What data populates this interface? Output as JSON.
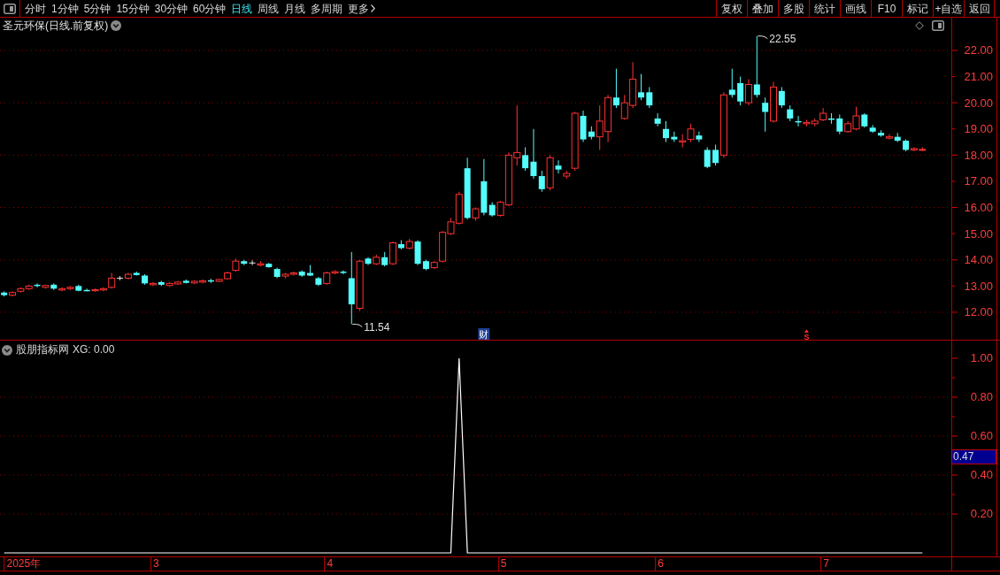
{
  "toolbar": {
    "periods": [
      {
        "label": "分时",
        "kind": "period",
        "selected": false
      },
      {
        "label": "1分钟",
        "kind": "period",
        "selected": false
      },
      {
        "label": "5分钟",
        "kind": "period",
        "selected": false
      },
      {
        "label": "15分钟",
        "kind": "period",
        "selected": false
      },
      {
        "label": "30分钟",
        "kind": "period",
        "selected": false
      },
      {
        "label": "60分钟",
        "kind": "period",
        "selected": false
      },
      {
        "label": "日线",
        "kind": "period",
        "selected": true
      },
      {
        "label": "周线",
        "kind": "period",
        "selected": false
      },
      {
        "label": "月线",
        "kind": "period",
        "selected": false
      },
      {
        "label": "多周期",
        "kind": "period",
        "selected": false
      },
      {
        "label": "更多",
        "kind": "menu",
        "selected": false
      }
    ],
    "buttons": [
      "复权",
      "叠加",
      "多股",
      "统计",
      "画线",
      "F10",
      "标记",
      "+自选",
      "返回"
    ]
  },
  "price_chart": {
    "title": "圣元环保(日线.前复权)",
    "high_label": "22.55",
    "low_label": "11.54",
    "event_markers": [
      {
        "kind": "finance",
        "label": "财"
      },
      {
        "kind": "signal",
        "label": "S"
      }
    ],
    "chart_data": {
      "type": "candlestick",
      "grid": true,
      "ylim": [
        10.95,
        23.25
      ],
      "yticks": [
        {
          "value": 22,
          "label": "22.00"
        },
        {
          "value": 21,
          "label": "21.00"
        },
        {
          "value": 20,
          "label": "20.00"
        },
        {
          "value": 19,
          "label": "19.00"
        },
        {
          "value": 18,
          "label": "18.00"
        },
        {
          "value": 17,
          "label": "17.00"
        },
        {
          "value": 16,
          "label": "16.00"
        },
        {
          "value": 15,
          "label": "15.00"
        },
        {
          "value": 14,
          "label": "14.00"
        },
        {
          "value": 13,
          "label": "13.00"
        },
        {
          "value": 12,
          "label": "12.00"
        }
      ],
      "categories": [
        null,
        null,
        null,
        null,
        null,
        null,
        null,
        null,
        null,
        null,
        null,
        null,
        null,
        null,
        null,
        null,
        null,
        null,
        null,
        null,
        null,
        null,
        null,
        null,
        null,
        null,
        null,
        null,
        null,
        null,
        null,
        null,
        null,
        null,
        null,
        null,
        null,
        null,
        null,
        null,
        null,
        null,
        null,
        null,
        null,
        null,
        null,
        null,
        null,
        null,
        null,
        null,
        null,
        null,
        null,
        null,
        null,
        null,
        null,
        null,
        null,
        null,
        null,
        null,
        null,
        null,
        null,
        null,
        null,
        null,
        null,
        null,
        null,
        null,
        null,
        null,
        null,
        null,
        null,
        null,
        null,
        null,
        null,
        null,
        null,
        null,
        null,
        null,
        null,
        null,
        null,
        null,
        null,
        null,
        null,
        null,
        null,
        null,
        null,
        null,
        null,
        null,
        null,
        null,
        null,
        null,
        null,
        null,
        null,
        null,
        null,
        null,
        null,
        null,
        null
      ],
      "ohlc": [
        [
          12.75,
          12.8,
          12.6,
          12.65
        ],
        [
          12.65,
          12.8,
          12.6,
          12.75
        ],
        [
          12.8,
          12.95,
          12.75,
          12.9
        ],
        [
          12.9,
          13.05,
          12.85,
          13.0
        ],
        [
          13.05,
          13.1,
          12.95,
          13.0
        ],
        [
          12.95,
          13.05,
          12.9,
          13.02
        ],
        [
          13.05,
          13.1,
          12.85,
          12.9
        ],
        [
          12.85,
          12.95,
          12.8,
          12.9
        ],
        [
          12.9,
          13.0,
          12.85,
          12.95
        ],
        [
          13.0,
          13.05,
          12.8,
          12.82
        ],
        [
          12.85,
          12.9,
          12.8,
          12.82
        ],
        [
          12.82,
          12.9,
          12.78,
          12.86
        ],
        [
          12.85,
          12.95,
          12.8,
          12.9
        ],
        [
          12.95,
          13.5,
          12.9,
          13.3
        ],
        [
          13.3,
          13.38,
          13.22,
          13.3
        ],
        [
          13.3,
          13.5,
          13.25,
          13.45
        ],
        [
          13.5,
          13.55,
          13.4,
          13.42
        ],
        [
          13.4,
          13.45,
          13.05,
          13.1
        ],
        [
          13.05,
          13.15,
          13.0,
          13.1
        ],
        [
          13.15,
          13.2,
          13.0,
          13.05
        ],
        [
          13.02,
          13.15,
          12.98,
          13.1
        ],
        [
          13.08,
          13.2,
          13.05,
          13.15
        ],
        [
          13.2,
          13.25,
          13.1,
          13.12
        ],
        [
          13.12,
          13.22,
          13.08,
          13.18
        ],
        [
          13.15,
          13.25,
          13.1,
          13.2
        ],
        [
          13.22,
          13.28,
          13.12,
          13.18
        ],
        [
          13.18,
          13.28,
          13.15,
          13.25
        ],
        [
          13.28,
          13.55,
          13.25,
          13.5
        ],
        [
          13.6,
          14.05,
          13.55,
          13.95
        ],
        [
          13.95,
          14.0,
          13.8,
          13.85
        ],
        [
          13.88,
          13.98,
          13.8,
          13.88
        ],
        [
          13.8,
          13.95,
          13.75,
          13.85
        ],
        [
          13.85,
          13.88,
          13.7,
          13.72
        ],
        [
          13.65,
          13.7,
          13.3,
          13.35
        ],
        [
          13.38,
          13.5,
          13.3,
          13.45
        ],
        [
          13.45,
          13.55,
          13.4,
          13.5
        ],
        [
          13.55,
          13.6,
          13.35,
          13.4
        ],
        [
          13.5,
          13.8,
          13.38,
          13.4
        ],
        [
          13.3,
          13.35,
          13.0,
          13.05
        ],
        [
          13.1,
          13.55,
          13.05,
          13.5
        ],
        [
          13.5,
          13.6,
          13.45,
          13.55
        ],
        [
          13.55,
          13.6,
          13.45,
          13.5
        ],
        [
          13.3,
          14.3,
          11.54,
          12.3
        ],
        [
          12.15,
          14.0,
          12.05,
          13.95
        ],
        [
          14.05,
          14.1,
          13.8,
          13.85
        ],
        [
          13.85,
          14.2,
          13.8,
          14.1
        ],
        [
          14.1,
          14.3,
          13.75,
          13.8
        ],
        [
          13.85,
          14.7,
          13.8,
          14.65
        ],
        [
          14.6,
          14.75,
          14.4,
          14.45
        ],
        [
          14.45,
          14.8,
          14.4,
          14.7
        ],
        [
          14.7,
          14.75,
          13.8,
          13.85
        ],
        [
          13.95,
          14.0,
          13.6,
          13.65
        ],
        [
          13.7,
          13.95,
          13.65,
          13.9
        ],
        [
          13.95,
          15.1,
          13.9,
          15.05
        ],
        [
          15.0,
          15.6,
          14.95,
          15.45
        ],
        [
          15.4,
          16.6,
          15.35,
          16.5
        ],
        [
          17.5,
          17.9,
          15.55,
          15.6
        ],
        [
          15.6,
          16.0,
          15.5,
          15.95
        ],
        [
          17.0,
          17.85,
          15.7,
          15.8
        ],
        [
          16.1,
          16.2,
          15.65,
          15.7
        ],
        [
          15.7,
          16.25,
          15.65,
          16.2
        ],
        [
          16.1,
          18.1,
          16.05,
          18.0
        ],
        [
          17.9,
          19.9,
          17.6,
          18.1
        ],
        [
          18.0,
          18.3,
          17.4,
          17.5
        ],
        [
          17.75,
          19.0,
          17.1,
          17.2
        ],
        [
          17.2,
          17.4,
          16.6,
          16.7
        ],
        [
          16.75,
          18.0,
          16.65,
          17.9
        ],
        [
          17.6,
          17.8,
          17.3,
          17.45
        ],
        [
          17.2,
          17.4,
          17.1,
          17.3
        ],
        [
          17.5,
          19.65,
          17.4,
          19.6
        ],
        [
          19.5,
          19.7,
          18.5,
          18.6
        ],
        [
          18.9,
          19.1,
          18.6,
          18.7
        ],
        [
          18.7,
          19.9,
          18.2,
          19.3
        ],
        [
          18.9,
          20.3,
          18.5,
          20.2
        ],
        [
          20.2,
          21.3,
          19.8,
          19.9
        ],
        [
          19.4,
          20.3,
          19.35,
          20.0
        ],
        [
          19.9,
          21.55,
          19.8,
          20.9
        ],
        [
          20.4,
          21.1,
          20.1,
          20.2
        ],
        [
          20.4,
          20.6,
          19.8,
          19.9
        ],
        [
          19.4,
          19.6,
          19.1,
          19.2
        ],
        [
          19.0,
          19.3,
          18.5,
          18.65
        ],
        [
          18.7,
          18.9,
          18.5,
          18.6
        ],
        [
          18.5,
          18.8,
          18.3,
          18.55
        ],
        [
          18.6,
          19.2,
          18.5,
          19.0
        ],
        [
          18.75,
          18.9,
          18.5,
          18.6
        ],
        [
          18.2,
          18.3,
          17.5,
          17.55
        ],
        [
          18.2,
          18.4,
          17.6,
          17.7
        ],
        [
          18.0,
          20.4,
          17.9,
          20.3
        ],
        [
          20.5,
          21.3,
          20.2,
          20.3
        ],
        [
          20.75,
          21.0,
          19.9,
          20.05
        ],
        [
          20.0,
          20.9,
          19.9,
          20.7
        ],
        [
          20.7,
          22.55,
          20.2,
          20.3
        ],
        [
          20.0,
          20.2,
          18.9,
          19.65
        ],
        [
          19.3,
          20.8,
          19.25,
          20.6
        ],
        [
          20.45,
          20.6,
          19.8,
          19.9
        ],
        [
          19.75,
          19.9,
          19.3,
          19.4
        ],
        [
          19.3,
          19.5,
          19.1,
          19.25
        ],
        [
          19.2,
          19.35,
          19.1,
          19.25
        ],
        [
          19.2,
          19.4,
          19.1,
          19.3
        ],
        [
          19.35,
          19.8,
          19.3,
          19.6
        ],
        [
          19.4,
          19.6,
          19.2,
          19.35
        ],
        [
          19.4,
          19.55,
          18.8,
          18.9
        ],
        [
          18.9,
          19.3,
          18.85,
          19.2
        ],
        [
          19.0,
          19.85,
          18.95,
          19.5
        ],
        [
          19.55,
          19.6,
          19.05,
          19.1
        ],
        [
          19.05,
          19.15,
          18.85,
          18.9
        ],
        [
          18.85,
          18.95,
          18.7,
          18.75
        ],
        [
          18.65,
          18.8,
          18.6,
          18.7
        ],
        [
          18.7,
          18.85,
          18.5,
          18.55
        ],
        [
          18.55,
          18.6,
          18.15,
          18.2
        ],
        [
          18.2,
          18.3,
          18.15,
          18.25
        ],
        [
          18.2,
          18.3,
          18.15,
          18.22
        ],
        null,
        null,
        null
      ]
    }
  },
  "indicator": {
    "name": "股朋指标网",
    "readout": "XG: 0.00",
    "cursor_value": "0.47",
    "chart_data": {
      "type": "line",
      "grid": true,
      "ylim": [
        -0.0181818181818182,
        1.0954545454545455
      ],
      "yticks": [
        {
          "value": 0.2,
          "label": "0.20"
        },
        {
          "value": 0.4,
          "label": "0.40"
        },
        {
          "value": 0.6,
          "label": "0.60"
        },
        {
          "value": 0.8,
          "label": "0.80"
        },
        {
          "value": 1.0,
          "label": "1.00"
        }
      ],
      "categories": [
        null,
        null,
        "2025年",
        null,
        null,
        null,
        null,
        null,
        null,
        null,
        null,
        null,
        null,
        null,
        null,
        null,
        null,
        null,
        "3",
        null,
        null,
        null,
        null,
        null,
        null,
        null,
        null,
        null,
        null,
        null,
        null,
        null,
        null,
        null,
        null,
        null,
        null,
        null,
        null,
        "4",
        null,
        null,
        null,
        null,
        null,
        null,
        null,
        null,
        null,
        null,
        null,
        null,
        null,
        null,
        null,
        null,
        null,
        null,
        null,
        null,
        "5",
        null,
        null,
        null,
        null,
        null,
        null,
        null,
        null,
        null,
        null,
        null,
        null,
        null,
        null,
        null,
        null,
        null,
        null,
        "6",
        null,
        null,
        null,
        null,
        null,
        null,
        null,
        null,
        null,
        null,
        null,
        null,
        null,
        null,
        null,
        null,
        null,
        null,
        null,
        "7",
        null,
        null,
        null,
        null,
        null,
        null,
        null,
        null,
        null,
        null,
        null,
        null,
        null,
        null,
        null
      ],
      "series": [
        {
          "color": "#ffffff",
          "values": [
            0,
            0,
            0,
            0,
            0,
            0,
            0,
            0,
            0,
            0,
            0,
            0,
            0,
            0,
            0,
            0,
            0,
            0,
            0,
            0,
            0,
            0,
            0,
            0,
            0,
            0,
            0,
            0,
            0,
            0,
            0,
            0,
            0,
            0,
            0,
            0,
            0,
            0,
            0,
            0,
            0,
            0,
            0,
            0,
            0,
            0,
            0,
            0,
            0,
            0,
            0,
            0,
            0,
            0,
            0,
            1,
            0,
            0,
            0,
            0,
            0,
            0,
            0,
            0,
            0,
            0,
            0,
            0,
            0,
            0,
            0,
            0,
            0,
            0,
            0,
            0,
            0,
            0,
            0,
            0,
            0,
            0,
            0,
            0,
            0,
            0,
            0,
            0,
            0,
            0,
            0,
            0,
            0,
            0,
            0,
            0,
            0,
            0,
            0,
            0,
            0,
            0,
            0,
            0,
            0,
            0,
            0,
            0,
            0,
            0,
            0,
            0,
            null,
            null,
            null
          ]
        }
      ]
    }
  }
}
